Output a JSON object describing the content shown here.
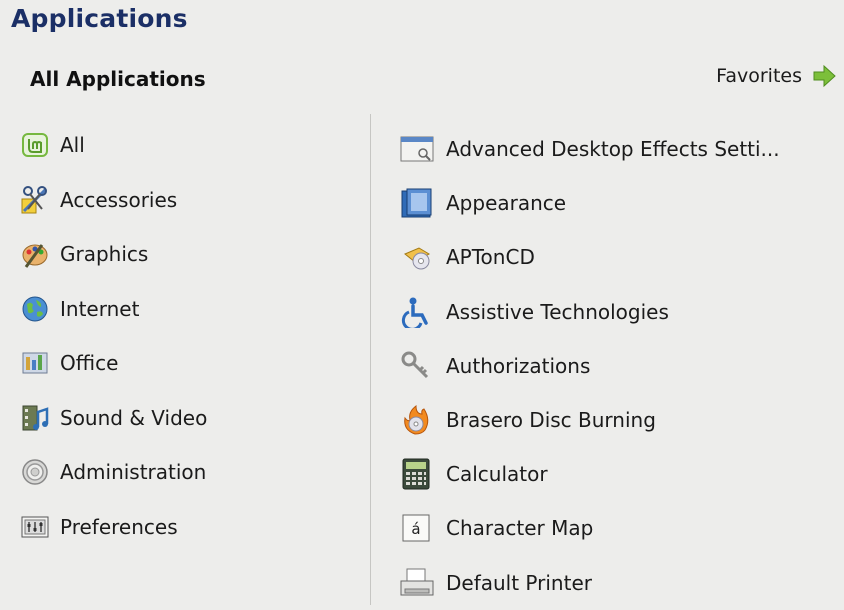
{
  "header": {
    "title": "Applications"
  },
  "panel": {
    "subtitle": "All Applications",
    "favorites_label": "Favorites"
  },
  "categories": [
    {
      "label": "All",
      "icon": "mint-logo-icon"
    },
    {
      "label": "Accessories",
      "icon": "accessories-icon"
    },
    {
      "label": "Graphics",
      "icon": "graphics-palette-icon"
    },
    {
      "label": "Internet",
      "icon": "globe-icon"
    },
    {
      "label": "Office",
      "icon": "office-icon"
    },
    {
      "label": "Sound & Video",
      "icon": "film-music-icon"
    },
    {
      "label": "Administration",
      "icon": "gear-icon"
    },
    {
      "label": "Preferences",
      "icon": "preferences-icon"
    }
  ],
  "applications": [
    {
      "label": "Advanced Desktop Effects Setti...",
      "icon": "window-settings-icon"
    },
    {
      "label": "Appearance",
      "icon": "appearance-icon"
    },
    {
      "label": "APTonCD",
      "icon": "aptoncd-icon"
    },
    {
      "label": "Assistive Technologies",
      "icon": "accessibility-icon"
    },
    {
      "label": "Authorizations",
      "icon": "keys-icon"
    },
    {
      "label": "Brasero Disc Burning",
      "icon": "disc-burning-icon"
    },
    {
      "label": "Calculator",
      "icon": "calculator-icon"
    },
    {
      "label": "Character Map",
      "icon": "character-map-icon"
    },
    {
      "label": "Default Printer",
      "icon": "printer-icon"
    }
  ],
  "colors": {
    "title": "#1b2f66",
    "background": "#ededeb",
    "arrow": "#7cbf3a",
    "mint": "#76b83f"
  }
}
